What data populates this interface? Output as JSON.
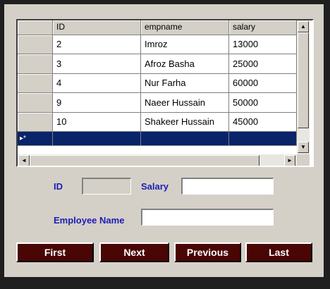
{
  "grid": {
    "columns": [
      "ID",
      "empname",
      "salary"
    ],
    "rows": [
      [
        "2",
        "Imroz",
        "13000"
      ],
      [
        "3",
        "Afroz Basha",
        "25000"
      ],
      [
        "4",
        "Nur Farha",
        "60000"
      ],
      [
        "9",
        "Naeer Hussain",
        "50000"
      ],
      [
        "10",
        "Shakeer Hussain",
        "45000"
      ]
    ],
    "new_row_marker": "▸*"
  },
  "form": {
    "id_label": "ID",
    "id_value": "",
    "salary_label": "Salary",
    "salary_value": "",
    "name_label": "Employee Name",
    "name_value": ""
  },
  "buttons": {
    "first": "First",
    "next": "Next",
    "previous": "Previous",
    "last": "Last"
  },
  "colors": {
    "form_bg": "#d4d0c8",
    "label_blue": "#1c1cb0",
    "button_bg": "#4a0505",
    "selection": "#0a246a"
  },
  "icons": {
    "scroll_up": "▲",
    "scroll_down": "▼",
    "scroll_left": "◄",
    "scroll_right": "►"
  }
}
